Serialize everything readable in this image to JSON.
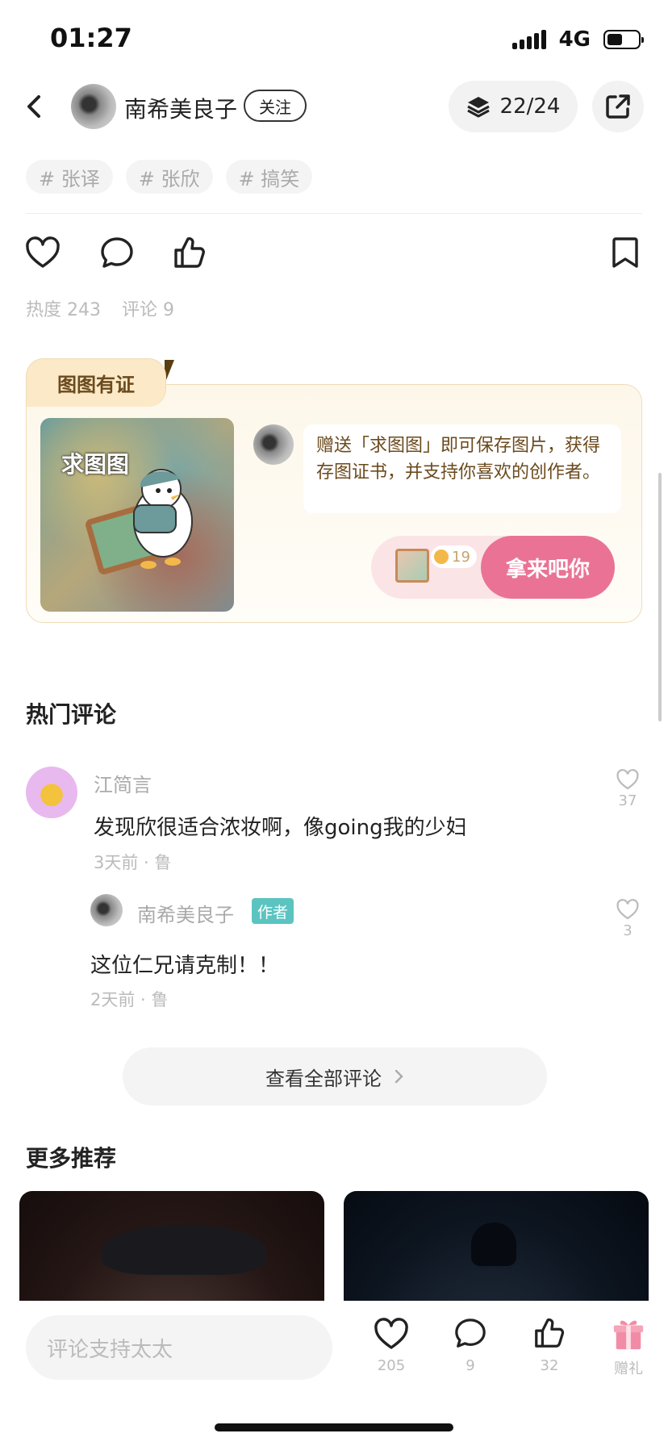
{
  "status_bar": {
    "time": "01:27",
    "network": "4G"
  },
  "header": {
    "author_name": "南希美良子",
    "follow_label": "关注",
    "page_counter": "22/24"
  },
  "tags": [
    "# 张译",
    "# 张欣",
    "# 搞笑"
  ],
  "stats": {
    "heat": "热度 243",
    "comments": "评论 9"
  },
  "promo": {
    "tab_label": "图图有证",
    "image_title": "求图图",
    "bubble_text": "赠送「求图图」即可保存图片，获得存图证书，并支持你喜欢的创作者。",
    "gift_count": "19",
    "button_label": "拿来吧你"
  },
  "hot_comments": {
    "title": "热门评论",
    "comments": [
      {
        "name": "江简言",
        "text": "发现欣很适合浓妆啊，像going我的少妇",
        "meta": "3天前 · 鲁",
        "likes": "37"
      },
      {
        "name": "南希美良子",
        "badge": "作者",
        "text": "这位仁兄请克制！！",
        "meta": "2天前 · 鲁",
        "likes": "3"
      }
    ],
    "see_all_label": "查看全部评论"
  },
  "more_recommend": {
    "title": "更多推荐"
  },
  "bottom_bar": {
    "input_placeholder": "评论支持太太",
    "like_count": "205",
    "comment_count": "9",
    "thumb_count": "32",
    "gift_label": "赠礼"
  },
  "colors": {
    "accent_pink": "#ea7395",
    "author_badge": "#5bc4c0",
    "promo_brown": "#6b4a1d"
  }
}
